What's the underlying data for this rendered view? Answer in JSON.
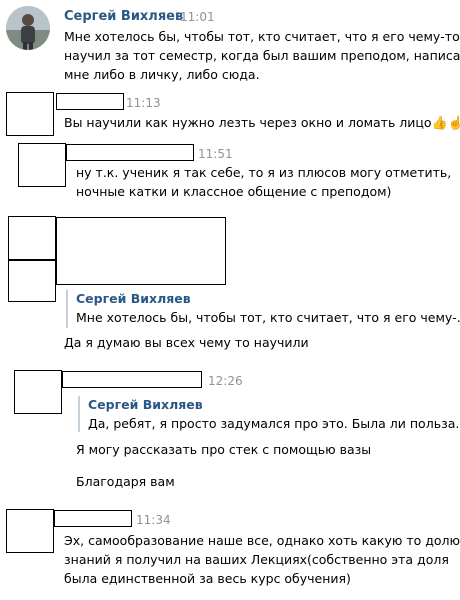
{
  "messages": [
    {
      "author": "Сергей Вихляев",
      "time": "11:01",
      "lines": [
        "Мне хотелось бы, чтобы тот, кто считает, что я его чему-то",
        "научил за тот семестр, когда был вашим преподом, написал",
        "мне либо в личку, либо сюда."
      ]
    },
    {
      "time": "11:13",
      "lines": [
        "Вы научили как нужно лезть через окно и ломать лицо"
      ],
      "emoji": "👍☝️"
    },
    {
      "time": "11:51",
      "lines": [
        "ну т.к. ученик я так себе, то я из плюсов могу отметить,",
        "ночные катки и классное общение с преподом)"
      ]
    },
    {
      "quote": {
        "author": "Сергей Вихляев",
        "text": "Мне хотелось бы, чтобы тот, кто считает, что я его чему-..."
      },
      "lines": [
        "Да я думаю вы всех чему то научили"
      ]
    },
    {
      "time": "12:26",
      "quote": {
        "author": "Сергей Вихляев",
        "text": "Да, ребят, я просто задумался про это. Была ли польза. ..."
      },
      "lines": [
        "Я могу рассказать про стек с помощью вазы"
      ],
      "extra": "Благодаря вам"
    },
    {
      "time": "11:34",
      "lines": [
        "Эх, самообразование наше все, однако хоть какую то долю",
        "знаний я получил на ваших Лекциях(собственно эта доля",
        "была единственной за весь курс обучения)"
      ]
    }
  ]
}
